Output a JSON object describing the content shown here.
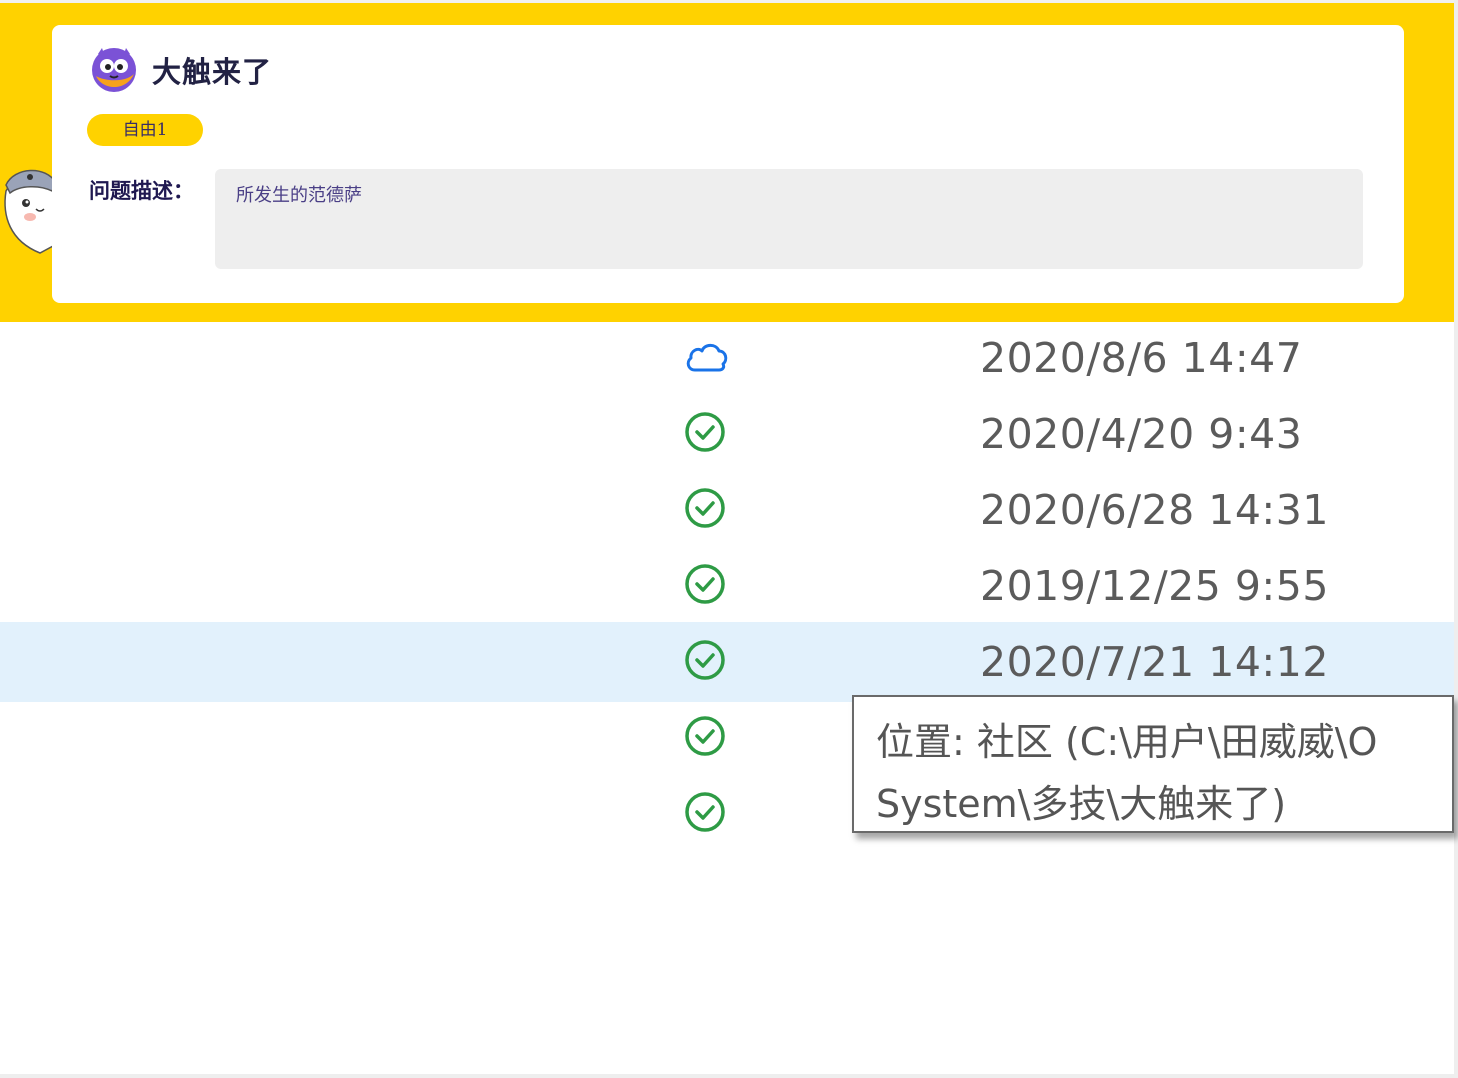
{
  "app": {
    "name": "大触来了",
    "tag": "自由1",
    "description_label": "问题描述：",
    "description_text": "所发生的范德萨",
    "brand_color": "#ffd200"
  },
  "file_rows": [
    {
      "status_icon": "cloud-icon",
      "date": "2020/8/6 14:47",
      "selected": false
    },
    {
      "status_icon": "synced-check-icon",
      "date": "2020/4/20 9:43",
      "selected": false
    },
    {
      "status_icon": "synced-check-icon",
      "date": "2020/6/28 14:31",
      "selected": false
    },
    {
      "status_icon": "synced-check-icon",
      "date": "2019/12/25 9:55",
      "selected": false
    },
    {
      "status_icon": "synced-check-icon",
      "date": "2020/7/21 14:12",
      "selected": true
    },
    {
      "status_icon": "synced-check-icon",
      "date": "",
      "selected": false
    },
    {
      "status_icon": "synced-check-icon",
      "date": "",
      "selected": false
    }
  ],
  "tooltip": {
    "line1": "位置: 社区 (C:\\用户\\田威威\\O",
    "line2": "System\\多技\\大触来了)"
  },
  "colors": {
    "selected_row": "#e2f1fc",
    "cloud_icon": "#1a73e8",
    "check_icon": "#2e9b45"
  }
}
